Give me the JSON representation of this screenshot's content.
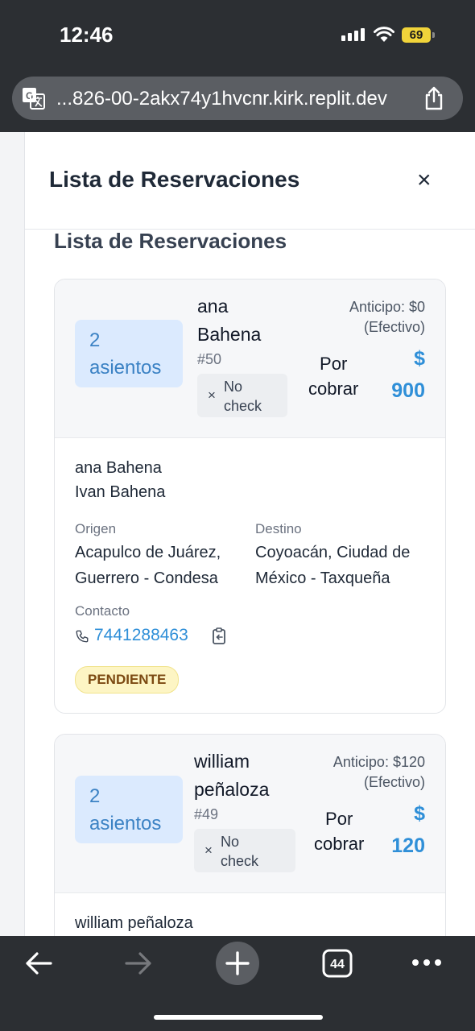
{
  "status_bar": {
    "time": "12:46",
    "battery": "69"
  },
  "browser": {
    "url": "...826-00-2akx74y1hvcnr.kirk.replit.dev",
    "tab_count": "44"
  },
  "modal": {
    "title": "Lista de Reservaciones",
    "close_label": "×"
  },
  "section_title": "Lista de Reservaciones",
  "reservations": [
    {
      "seats_count": "2",
      "seats_label": "asientos",
      "name_line1": "ana",
      "name_line2": "Bahena",
      "id": "#50",
      "check_x": "×",
      "check_line1": "No",
      "check_line2": "check",
      "anticipo_line1": "Anticipo: $0",
      "anticipo_line2": "(Efectivo)",
      "por_line1": "Por",
      "por_line2": "cobrar",
      "currency": "$",
      "amount": "900",
      "passengers": [
        "ana Bahena",
        "Ivan Bahena"
      ],
      "origen_label": "Origen",
      "origen_line1": "Acapulco de Juárez,",
      "origen_line2": "Guerrero - Condesa",
      "destino_label": "Destino",
      "destino_line1": "Coyoacán, Ciudad de",
      "destino_line2": "México - Taxqueña",
      "contacto_label": "Contacto",
      "phone": "7441288463",
      "status": "PENDIENTE"
    },
    {
      "seats_count": "2",
      "seats_label": "asientos",
      "name_line1": "william",
      "name_line2": "peñaloza",
      "id": "#49",
      "check_x": "×",
      "check_line1": "No",
      "check_line2": "check",
      "anticipo_line1": "Anticipo: $120",
      "anticipo_line2": "(Efectivo)",
      "por_line1": "Por",
      "por_line2": "cobrar",
      "currency": "$",
      "amount": "120",
      "passengers": [
        "william peñaloza"
      ]
    }
  ],
  "colors": {
    "accent": "#2f8fd8",
    "seat_bg": "#dbeafe",
    "badge_bg": "#fdf5c4",
    "chrome": "#2c2f33"
  },
  "icons": [
    "translate-icon",
    "share-icon",
    "phone-icon",
    "copy-icon",
    "back-arrow-icon",
    "forward-arrow-icon",
    "plus-icon",
    "tabs-icon",
    "more-icon"
  ]
}
